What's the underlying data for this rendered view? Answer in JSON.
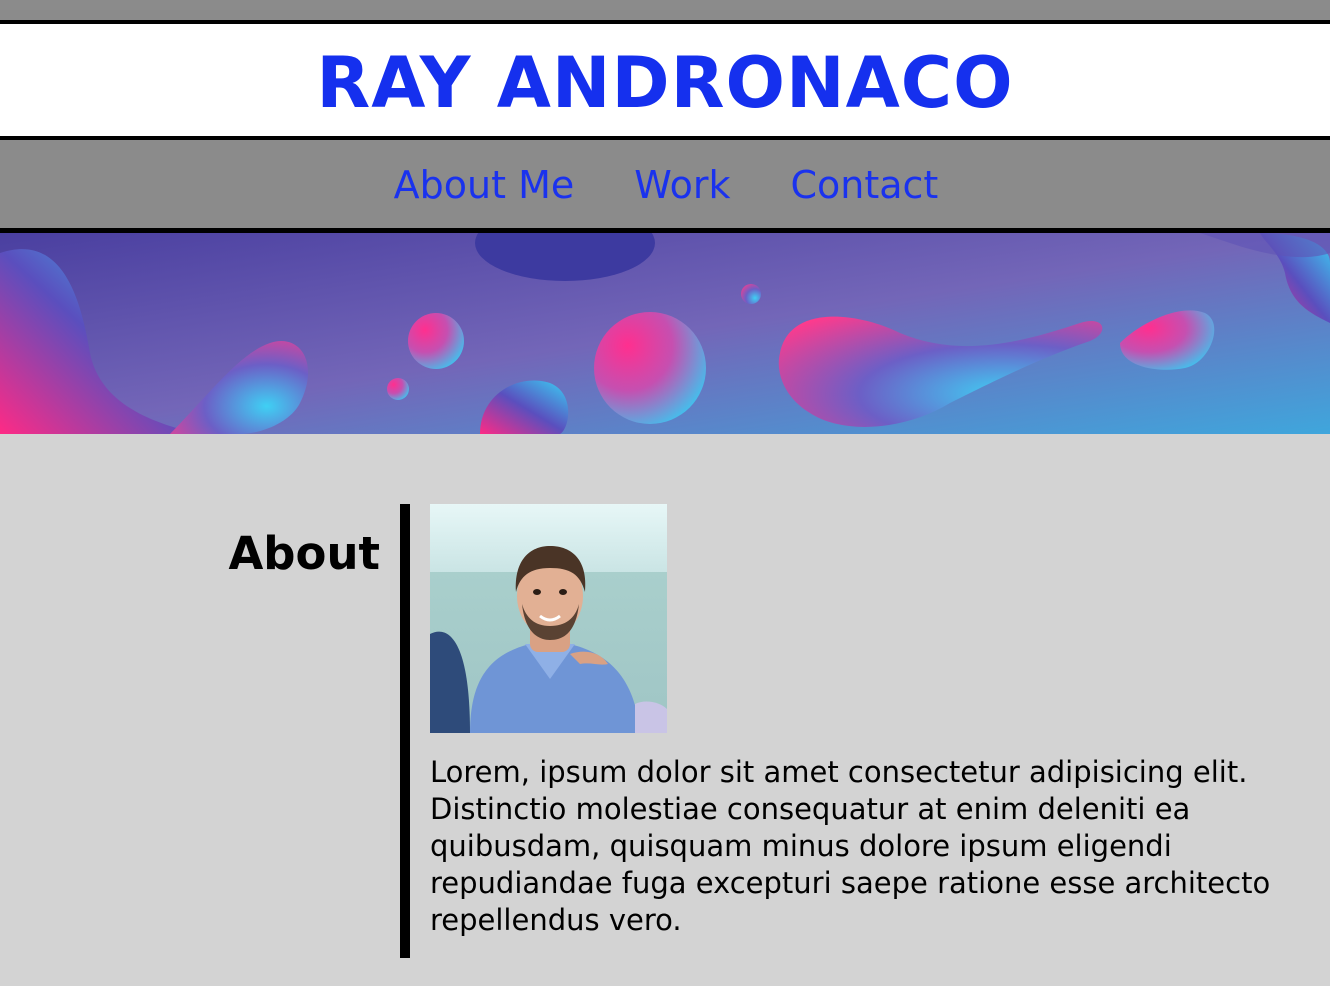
{
  "header": {
    "title": "RAY ANDRONACO"
  },
  "nav": {
    "items": [
      {
        "label": "About Me"
      },
      {
        "label": "Work"
      },
      {
        "label": "Contact"
      }
    ]
  },
  "about": {
    "heading": "About",
    "bio": "Lorem, ipsum dolor sit amet consectetur adipisicing elit. Distinctio molestiae consequatur at enim deleniti ea quibusdam, quisquam minus dolore ipsum eligendi repudiandae fuga excepturi saepe ratione esse architecto repellendus vero."
  },
  "colors": {
    "accent": "#1a32ee",
    "nav_bg": "#8b8b8b",
    "page_bg": "#d3d3d3"
  }
}
